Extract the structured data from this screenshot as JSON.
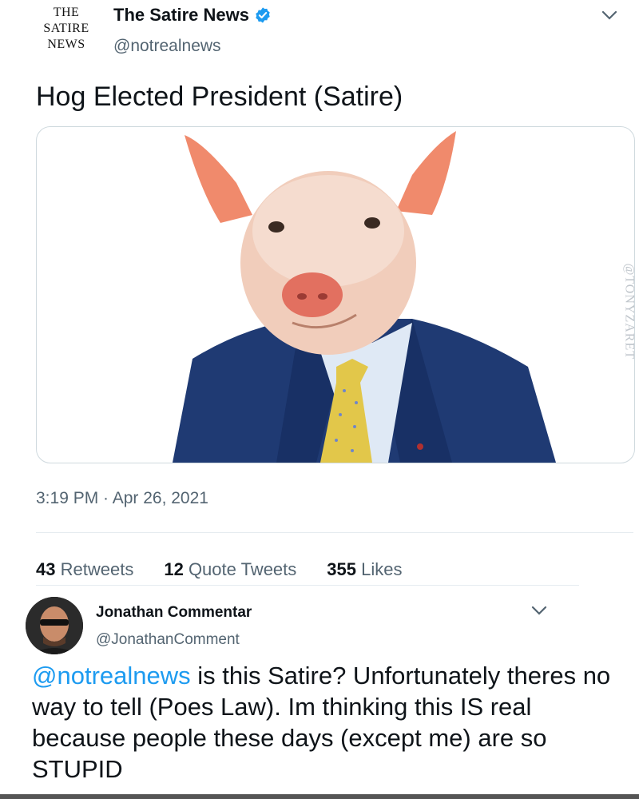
{
  "tweet": {
    "logo_lines": [
      "THE",
      "SATIRE",
      "NEWS"
    ],
    "display_name": "The Satire News",
    "handle": "@notrealnews",
    "text": "Hog Elected President (Satire)",
    "image_watermark": "@TONYZARET",
    "timestamp": "3:19 PM · Apr 26, 2021",
    "stats": {
      "retweets_count": "43",
      "retweets_label": "Retweets",
      "quotes_count": "12",
      "quotes_label": "Quote Tweets",
      "likes_count": "355",
      "likes_label": "Likes"
    }
  },
  "reply": {
    "display_name": "Jonathan Commentar",
    "handle": "@JonathanComment",
    "mention": "@notrealnews",
    "text": " is this Satire? Unfortunately theres no way to tell (Poes Law). Im thinking this IS real because people these days (except me) are so STUPID"
  },
  "colors": {
    "accent": "#1d9bf0",
    "muted": "#536471",
    "text": "#0f1419"
  },
  "icons": [
    "verified-badge-icon",
    "chevron-down-icon"
  ]
}
